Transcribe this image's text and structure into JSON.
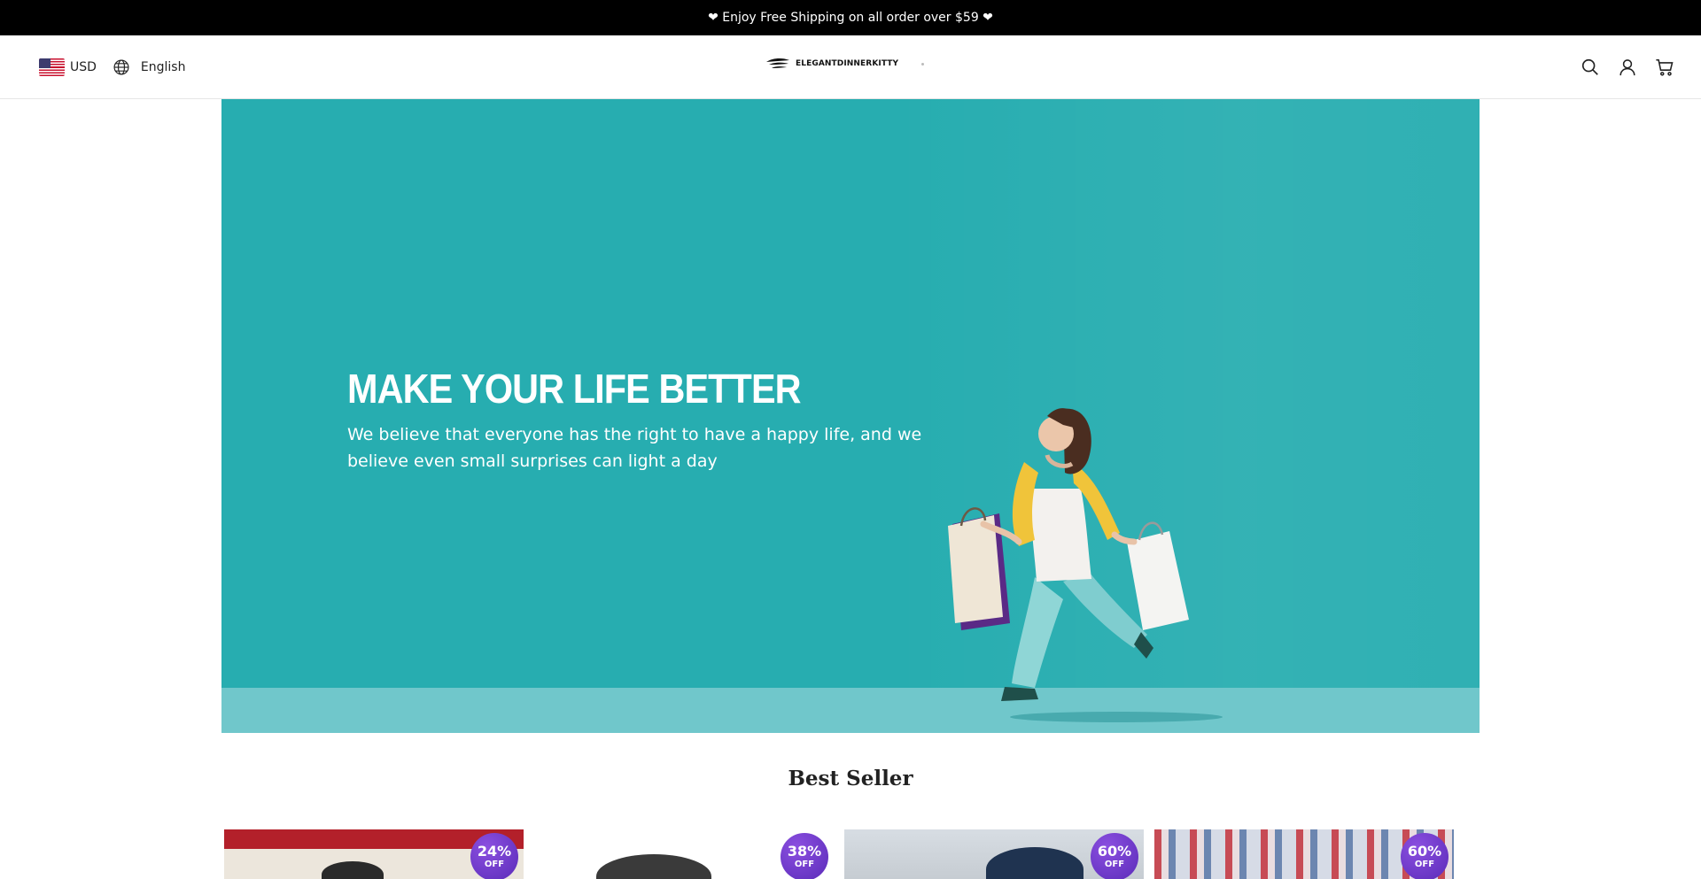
{
  "announcement": {
    "text": "❤ Enjoy Free Shipping on all order over $59 ❤"
  },
  "header": {
    "currency": "USD",
    "language": "English",
    "brand": "ELEGANTDINNERKITTY",
    "icons": [
      "search-icon",
      "account-icon",
      "cart-icon"
    ]
  },
  "hero": {
    "title": "MAKE YOUR LIFE BETTER",
    "subtitle": "We believe that everyone has the right to have a happy life, and we believe even small surprises can light a day",
    "background_color": "#27adb0"
  },
  "best_seller": {
    "title": "Best Seller",
    "products": [
      {
        "discount": "24%",
        "off_label": "OFF"
      },
      {
        "discount": "38%",
        "off_label": "OFF"
      },
      {
        "discount": "60%",
        "off_label": "OFF"
      },
      {
        "discount": "60%",
        "off_label": "OFF"
      }
    ]
  },
  "colors": {
    "badge": "#6b3ad0",
    "announcement_bg": "#000000"
  }
}
